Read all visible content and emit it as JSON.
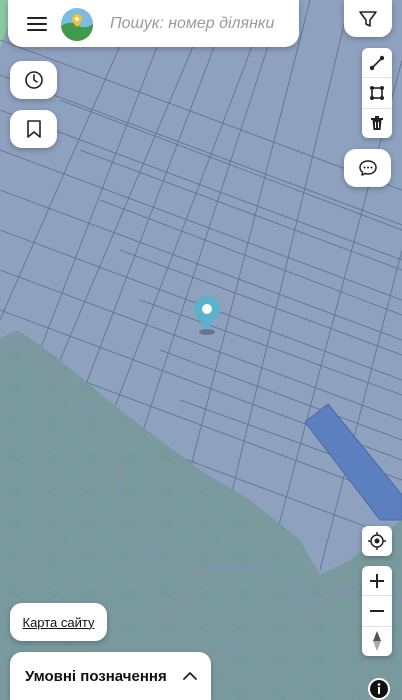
{
  "search": {
    "placeholder": "Пошук: номер ділянки"
  },
  "footer": {
    "sitemap_label": "Карта сайту",
    "legend_label": "Умовні позначення"
  },
  "map": {
    "colors": {
      "land": "#8ea1bf",
      "forest": "#7a9aa0",
      "parcel_line": "#5f6f8b",
      "highlight": "#5c7fc0",
      "marker": "#5bb2cc"
    }
  },
  "icons": [
    "menu-icon",
    "app-logo-icon",
    "filter-icon",
    "history-icon",
    "bookmark-icon",
    "draw-line-icon",
    "draw-polygon-icon",
    "trash-icon",
    "chat-icon",
    "locate-icon",
    "zoom-in-icon",
    "zoom-out-icon",
    "compass-icon",
    "chevron-up-icon",
    "info-icon",
    "location-pin-icon"
  ]
}
